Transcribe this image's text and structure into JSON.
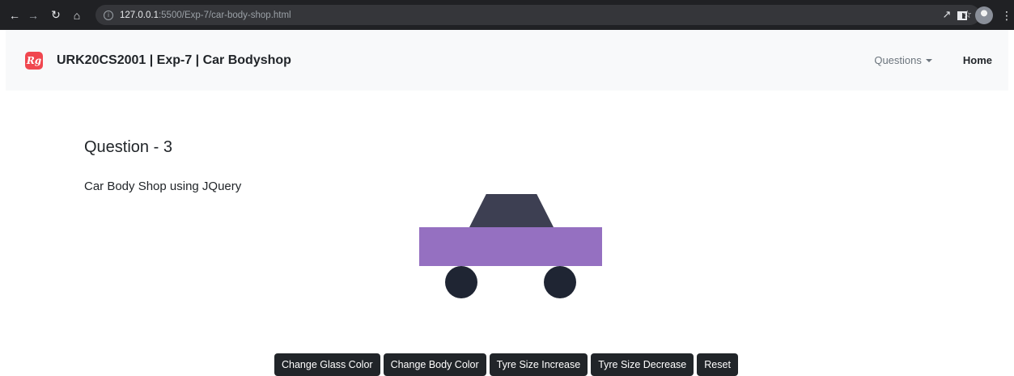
{
  "browser": {
    "url_host": "127.0.0.1",
    "url_path": ":5500/Exp-7/car-body-shop.html"
  },
  "navbar": {
    "logo_text": "Rg",
    "brand": "URK20CS2001 | Exp-7 | Car Bodyshop",
    "questions_label": "Questions",
    "home_label": "Home"
  },
  "main": {
    "title": "Question - 3",
    "subtitle": "Car Body Shop using JQuery"
  },
  "car": {
    "glass_color": "#3d3f52",
    "body_color": "#9570c1",
    "tyre_color": "#1f2533"
  },
  "buttons": {
    "glass": "Change Glass Color",
    "body": "Change Body Color",
    "tyre_inc": "Tyre Size Increase",
    "tyre_dec": "Tyre Size Decrease",
    "reset": "Reset"
  }
}
